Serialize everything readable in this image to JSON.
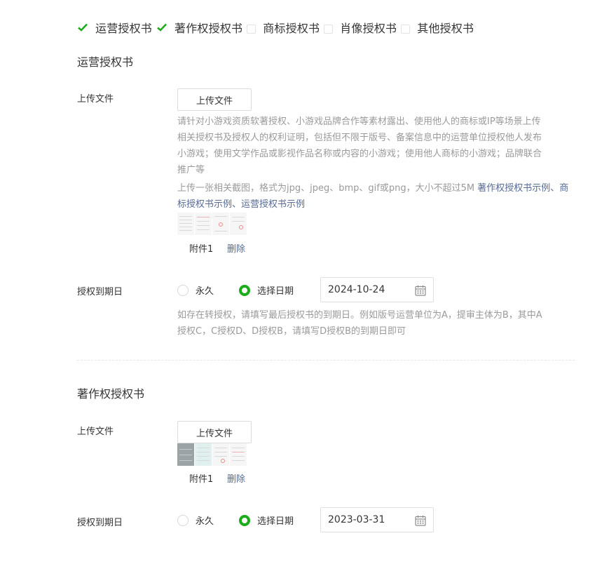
{
  "auth_types": [
    {
      "label": "运营授权书",
      "checked": true
    },
    {
      "label": "著作权授权书",
      "checked": true
    },
    {
      "label": "商标授权书",
      "checked": false
    },
    {
      "label": "肖像授权书",
      "checked": false
    },
    {
      "label": "其他授权书",
      "checked": false
    }
  ],
  "colors": {
    "accent": "#1aad19",
    "link": "#576b95",
    "muted": "#9a9a9a"
  },
  "sections": {
    "operation": {
      "title": "运营授权书",
      "upload_label": "上传文件",
      "upload_button": "上传文件",
      "desc_line1": "请针对小游戏资质软著授权、小游戏品牌合作等素材露出、使用他人的商标或IP等场景上传",
      "desc_line2": "相关授权书及授权人的权利证明，包括但不限于版号、备案信息中的运营单位授权他人发布",
      "desc_line3": "小游戏；使用文学作品或影视作品名称或内容的小游戏；使用他人商标的小游戏；品牌联合",
      "desc_line4": "推广等",
      "upload_hint": "上传一张相关截图，格式为jpg、jpeg、bmp、gif或png，大小不超过5M ",
      "link_copyright": "著作权授权书示例",
      "link_sep1": "、",
      "link_trademark": "商标授权书示例",
      "link_sep2": "、",
      "link_operation": "运营授权书示例",
      "attachment_name": "附件1",
      "delete_label": "删除",
      "expiry_label": "授权到期日",
      "radio_forever": "永久",
      "radio_date": "选择日期",
      "date_value": "2024-10-24",
      "expiry_hint_line1": "如存在转授权，请填写最后授权书的到期日。例如版号运营单位为A，提审主体为B，其中A",
      "expiry_hint_line2": "授权C，C授权D、D授权B，请填写D授权B的到期日即可"
    },
    "copyright": {
      "title": "著作权授权书",
      "upload_label": "上传文件",
      "upload_button": "上传文件",
      "attachment_name": "附件1",
      "delete_label": "删除",
      "expiry_label": "授权到期日",
      "radio_forever": "永久",
      "radio_date": "选择日期",
      "date_value": "2023-03-31"
    }
  }
}
